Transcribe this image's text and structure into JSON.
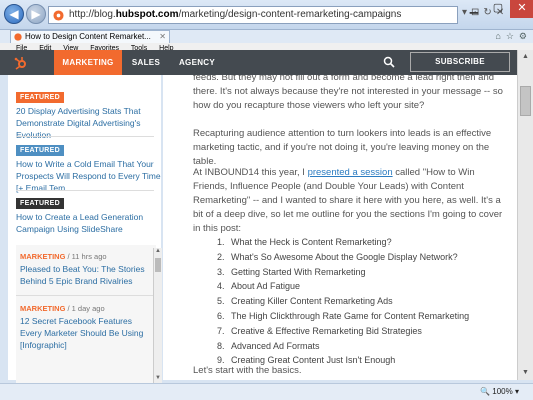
{
  "browser": {
    "url_prefix": "http://blog.",
    "url_domain": "hubspot.com",
    "url_path": "/marketing/design-content-remarketing-campaigns",
    "tab_title": "How to Design Content Remarket...",
    "menu": [
      "File",
      "Edit",
      "View",
      "Favorites",
      "Tools",
      "Help"
    ],
    "zoom": "100%"
  },
  "site": {
    "nav": [
      "MARKETING",
      "SALES",
      "AGENCY"
    ],
    "subscribe": "SUBSCRIBE",
    "accent": "#f26a2e",
    "header_bg": "#444a50"
  },
  "sidebar": {
    "featured": [
      {
        "badge": "FEATURED",
        "color": "#f26a2e",
        "title": "20 Display Advertising Stats That Demonstrate Digital Advertising's Evolution"
      },
      {
        "badge": "FEATURED",
        "color": "#4e8fc2",
        "title": "How to Write a Cold Email That Your Prospects Will Respond to Every Time [+ Email Tem..."
      },
      {
        "badge": "FEATURED",
        "color": "#333333",
        "title": "How to Create a Lead Generation Campaign Using SlideShare"
      }
    ],
    "recent": [
      {
        "category": "MARKETING",
        "time": " / 11 hrs ago",
        "title": "Pleased to Beat You: The Stories Behind 5 Epic Brand Rivalries"
      },
      {
        "category": "MARKETING",
        "time": " / 1 day ago",
        "title": "12 Secret Facebook Features Every Marketer Should Be Using [Infographic]"
      }
    ]
  },
  "article": {
    "p1": "feeds. But they may not fill out a form and become a lead right then and there. It's not always because they're not interested in your message -- so how do you recapture those viewers who left your site?",
    "p2": "Recapturing audience attention to turn lookers into leads is an effective marketing tactic, and if you're not doing it, you're leaving money on the table.",
    "p3_a": "At INBOUND14 this year, I ",
    "p3_link": "presented a session",
    "p3_b": " called \"How to Win Friends, Influence People (and Double Your Leads) with Content Remarketing\" -- and I wanted to share it here with you here, as well. It's a bit of a deep dive, so let me outline for you the sections I'm going to cover in this post:",
    "toc": [
      "What the Heck is Content Remarketing?",
      "What's So Awesome About the Google Display Network?",
      "Getting Started With Remarketing",
      "About Ad Fatigue",
      "Creating Killer Content Remarketing Ads",
      "The High Clickthrough Rate Game for Content Remarketing",
      "Creative & Effective Remarketing Bid Strategies",
      "Advanced Ad Formats",
      "Creating Great Content Just Isn't Enough"
    ],
    "closing": "Let's start with the basics."
  }
}
